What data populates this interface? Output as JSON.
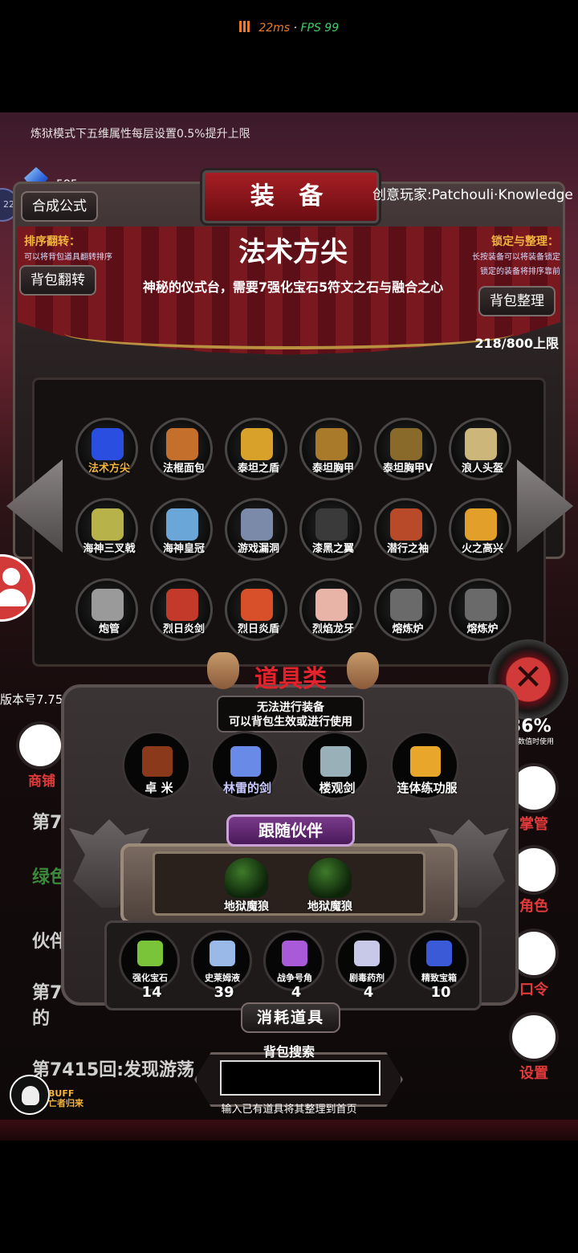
{
  "status": {
    "ping": "22ms",
    "separator": "·",
    "fps": "FPS 99"
  },
  "notice": "炼狱模式下五维属性每层设置0.5%提升上限",
  "gem_count": "585",
  "side_badge": "22",
  "player": "创意玩家:Patchouli·Knowledge",
  "equip_title": "装 备",
  "buttons": {
    "formula": "合成公式",
    "bag_flip": "背包翻转",
    "bag_sort": "背包整理"
  },
  "sort_hint": {
    "title": "排序翻转：",
    "desc": "可以将背包道具翻转排序"
  },
  "lock_hint": {
    "title": "锁定与整理：",
    "desc1": "长按装备可以将装备锁定",
    "desc2": "锁定的装备将排序靠前"
  },
  "capacity": "218/800上限",
  "selected": {
    "name": "法术方尖",
    "desc": "神秘的仪式台，需要7强化宝石5符文之石与融合之心"
  },
  "equipment": [
    {
      "label": "法术方尖",
      "color": "#2a4fe0"
    },
    {
      "label": "法棍面包",
      "color": "#c4702c"
    },
    {
      "label": "泰坦之盾",
      "color": "#d8a22a"
    },
    {
      "label": "泰坦胸甲",
      "color": "#a87a2a"
    },
    {
      "label": "泰坦胸甲V",
      "color": "#8a6a2a"
    },
    {
      "label": "浪人头盔",
      "color": "#cdb67a"
    },
    {
      "label": "海神三叉戟",
      "color": "#b8b24a"
    },
    {
      "label": "海神皇冠",
      "color": "#6aa6d8"
    },
    {
      "label": "游戏漏洞",
      "color": "#7a8aa8"
    },
    {
      "label": "漆黑之翼",
      "color": "#3a3a3a"
    },
    {
      "label": "潜行之袖",
      "color": "#b84a2a"
    },
    {
      "label": "火之高兴",
      "color": "#e2a02a"
    },
    {
      "label": "炮管",
      "color": "#9a9a9a"
    },
    {
      "label": "烈日炎剑",
      "color": "#c43a2a"
    },
    {
      "label": "烈日炎盾",
      "color": "#d8502a"
    },
    {
      "label": "烈焰龙牙",
      "color": "#e8b4a8"
    },
    {
      "label": "熔炼炉",
      "color": "#6a6a6a"
    },
    {
      "label": "熔炼炉",
      "color": "#6a6a6a"
    }
  ],
  "version": "版本号7.75",
  "close_icon": "✕",
  "shop_label": "商铺",
  "right_stat": {
    "value": "36%",
    "sub": "真数值时使用"
  },
  "side_menu": [
    "掌管",
    "角色",
    "口令",
    "设置"
  ],
  "log_lines": [
    "第7",
    "绿色史",
    "伙伴",
    "第7",
    "的",
    "第7415回:发现游荡"
  ],
  "props": {
    "title": "道具类",
    "note1": "无法进行装备",
    "note2": "可以背包生效或进行使用",
    "items": [
      {
        "label": "卓 米",
        "color": "#8a3a1a"
      },
      {
        "label": "林雷的剑",
        "color": "#6a8ae8"
      },
      {
        "label": "楼观剑",
        "color": "#9ab0b8"
      },
      {
        "label": "连体练功服",
        "color": "#e8a62a"
      }
    ]
  },
  "partners": {
    "title": "跟随伙伴",
    "items": [
      {
        "label": "地狱魔狼"
      },
      {
        "label": "地狱魔狼"
      }
    ]
  },
  "consumables": [
    {
      "label": "强化宝石",
      "count": "14",
      "color": "#7ac43a"
    },
    {
      "label": "史莱姆液",
      "count": "39",
      "color": "#9ab8e8"
    },
    {
      "label": "战争号角",
      "count": "4",
      "color": "#a85ad8"
    },
    {
      "label": "剧毒药剂",
      "count": "4",
      "color": "#c8c8e8"
    },
    {
      "label": "精致宝箱",
      "count": "10",
      "color": "#3a5ad8"
    }
  ],
  "consumables_title": "消耗道具",
  "search": {
    "label": "背包搜索",
    "hint": "输入已有道具将其整理到首页",
    "value": ""
  },
  "buff": {
    "line1": "BUFF",
    "line2": "亡者归来"
  }
}
